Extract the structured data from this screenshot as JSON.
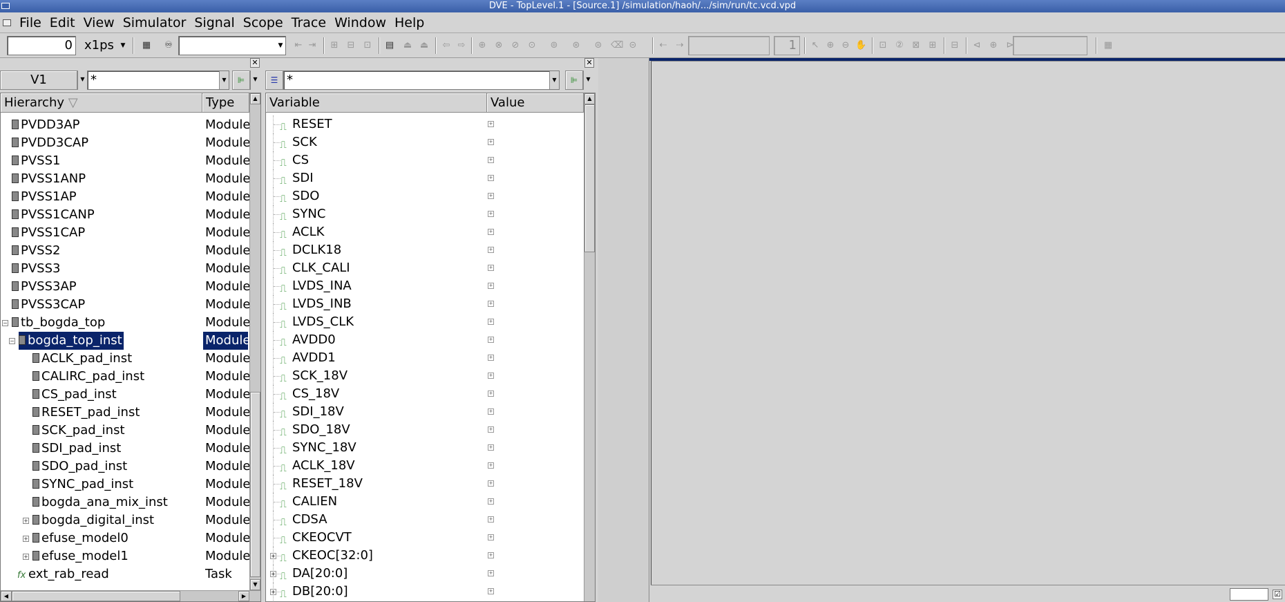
{
  "window": {
    "title": "DVE - TopLevel.1 - [Source.1]  /simulation/haoh/.../sim/run/tc.vcd.vpd"
  },
  "menu": [
    {
      "label": "File"
    },
    {
      "label": "Edit"
    },
    {
      "label": "View"
    },
    {
      "label": "Simulator"
    },
    {
      "label": "Signal"
    },
    {
      "label": "Scope"
    },
    {
      "label": "Trace"
    },
    {
      "label": "Window"
    },
    {
      "label": "Help"
    }
  ],
  "toolbar": {
    "time_value": "0",
    "time_unit": "x1ps",
    "search_value": "",
    "page_number": "1",
    "zoom_value": ""
  },
  "hierarchy": {
    "view_selector": "V1",
    "filter": "*",
    "col_hierarchy": "Hierarchy",
    "col_type": "Type",
    "rows": [
      {
        "name": "PVDD3AP",
        "type": "Module"
      },
      {
        "name": "PVDD3CAP",
        "type": "Module"
      },
      {
        "name": "PVSS1",
        "type": "Module"
      },
      {
        "name": "PVSS1ANP",
        "type": "Module"
      },
      {
        "name": "PVSS1AP",
        "type": "Module"
      },
      {
        "name": "PVSS1CANP",
        "type": "Module"
      },
      {
        "name": "PVSS1CAP",
        "type": "Module"
      },
      {
        "name": "PVSS2",
        "type": "Module"
      },
      {
        "name": "PVSS3",
        "type": "Module"
      },
      {
        "name": "PVSS3AP",
        "type": "Module"
      },
      {
        "name": "PVSS3CAP",
        "type": "Module"
      },
      {
        "name": "tb_bogda_top",
        "type": "Module"
      },
      {
        "name": "bogda_top_inst",
        "type": "Module"
      },
      {
        "name": "ACLK_pad_inst",
        "type": "Module"
      },
      {
        "name": "CALIRC_pad_inst",
        "type": "Module"
      },
      {
        "name": "CS_pad_inst",
        "type": "Module"
      },
      {
        "name": "RESET_pad_inst",
        "type": "Module"
      },
      {
        "name": "SCK_pad_inst",
        "type": "Module"
      },
      {
        "name": "SDI_pad_inst",
        "type": "Module"
      },
      {
        "name": "SDO_pad_inst",
        "type": "Module"
      },
      {
        "name": "SYNC_pad_inst",
        "type": "Module"
      },
      {
        "name": "bogda_ana_mix_inst",
        "type": "Module"
      },
      {
        "name": "bogda_digital_inst",
        "type": "Module"
      },
      {
        "name": "efuse_model0",
        "type": "Module"
      },
      {
        "name": "efuse_model1",
        "type": "Module"
      },
      {
        "name": "ext_rab_read",
        "type": "Task"
      }
    ]
  },
  "variables": {
    "filter": "*",
    "col_variable": "Variable",
    "col_value": "Value",
    "rows": [
      {
        "name": "RESET"
      },
      {
        "name": "SCK"
      },
      {
        "name": "CS"
      },
      {
        "name": "SDI"
      },
      {
        "name": "SDO"
      },
      {
        "name": "SYNC"
      },
      {
        "name": "ACLK"
      },
      {
        "name": "DCLK18"
      },
      {
        "name": "CLK_CALI"
      },
      {
        "name": "LVDS_INA"
      },
      {
        "name": "LVDS_INB"
      },
      {
        "name": "LVDS_CLK"
      },
      {
        "name": "AVDD0"
      },
      {
        "name": "AVDD1"
      },
      {
        "name": "SCK_18V"
      },
      {
        "name": "CS_18V"
      },
      {
        "name": "SDI_18V"
      },
      {
        "name": "SDO_18V"
      },
      {
        "name": "SYNC_18V"
      },
      {
        "name": "ACLK_18V"
      },
      {
        "name": "RESET_18V"
      },
      {
        "name": "CALIEN"
      },
      {
        "name": "CDSA"
      },
      {
        "name": "CKEOCVT"
      },
      {
        "name": "CKEOC[32:0]"
      },
      {
        "name": "DA[20:0]"
      },
      {
        "name": "DB[20:0]"
      }
    ]
  },
  "colors": {
    "selection": "#0a246a",
    "title_bar": "#3a5fa8",
    "signal_icon": "#2a8a2a"
  }
}
